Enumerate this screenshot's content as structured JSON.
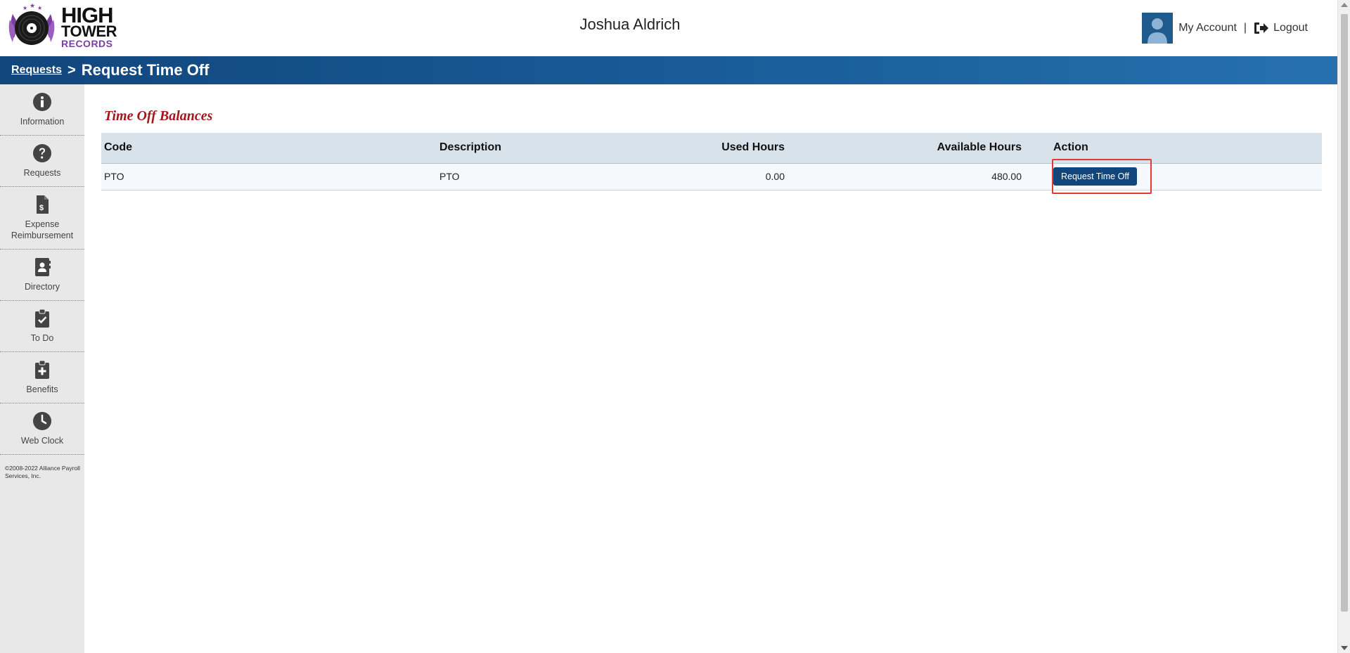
{
  "logo": {
    "line1": "HIGH",
    "line2": "TOWER",
    "line3": "RECORDS"
  },
  "header": {
    "user_name": "Joshua Aldrich",
    "my_account": "My Account",
    "separator": "|",
    "logout": "Logout",
    "avatar_color": "#1f5a8c"
  },
  "breadcrumb": {
    "parent": "Requests",
    "separator": ">",
    "current": "Request Time Off"
  },
  "sidebar": {
    "items": [
      {
        "label": "Information",
        "icon": "info-circle-icon"
      },
      {
        "label": "Requests",
        "icon": "question-circle-icon"
      },
      {
        "label_line1": "Expense",
        "label_line2": "Reimbursement",
        "icon": "dollar-document-icon"
      },
      {
        "label": "Directory",
        "icon": "address-book-icon"
      },
      {
        "label": "To Do",
        "icon": "clipboard-check-icon"
      },
      {
        "label": "Benefits",
        "icon": "clipboard-plus-icon"
      },
      {
        "label": "Web Clock",
        "icon": "clock-icon"
      }
    ],
    "copyright_line1": "©2008-2022 Alliance Payroll",
    "copyright_line2": "Services, Inc."
  },
  "main": {
    "section_title": "Time Off Balances",
    "table": {
      "headers": [
        "Code",
        "Description",
        "Used Hours",
        "Available Hours",
        "Action"
      ],
      "rows": [
        {
          "code": "PTO",
          "description": "PTO",
          "used_hours": "0.00",
          "available_hours": "480.00",
          "action_label": "Request Time Off"
        }
      ]
    }
  },
  "colors": {
    "brand_blue": "#11467c",
    "title_red": "#a3171b",
    "highlight_red": "#e53935"
  }
}
